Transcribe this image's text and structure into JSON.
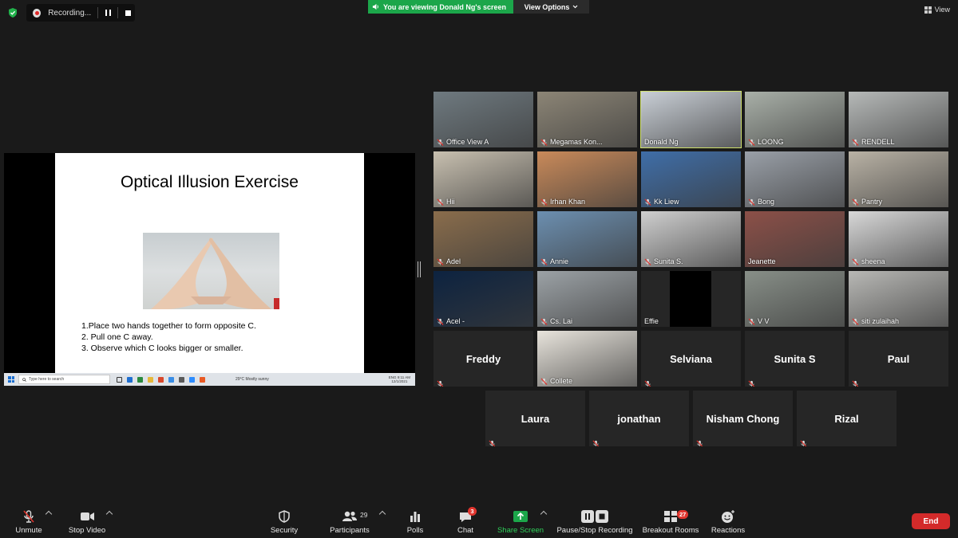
{
  "recording": {
    "label": "Recording..."
  },
  "banner": {
    "viewing_text": "You are viewing Donald Ng's screen",
    "view_options": "View Options"
  },
  "view": {
    "label": "View"
  },
  "slide": {
    "title": "Optical Illusion Exercise",
    "steps": [
      "1.Place two hands together to form opposite C.",
      "2. Pull one C away.",
      "3. Observe which C looks bigger or smaller."
    ]
  },
  "taskbar": {
    "search_placeholder": "Type here to search",
    "weather": "29°C  Mostly sunny",
    "lang": "ENG",
    "time": "9:11 AM",
    "date": "12/1/2021"
  },
  "participants_grid": [
    {
      "name": "Office View A",
      "muted": true,
      "video": true,
      "bg": "#6f7a80"
    },
    {
      "name": "Megamas Kon...",
      "muted": true,
      "video": true,
      "bg": "#8c8576"
    },
    {
      "name": "Donald Ng",
      "muted": false,
      "video": true,
      "active": true,
      "bg": "#c9cfd6"
    },
    {
      "name": "LOONG",
      "muted": true,
      "video": true,
      "bg": "#a9b0a8"
    },
    {
      "name": "RENDELL",
      "muted": true,
      "video": true,
      "bg": "#b6b9b8"
    },
    {
      "name": "Hii",
      "muted": true,
      "video": true,
      "bg": "#c8c0b0"
    },
    {
      "name": "Irhan Khan",
      "muted": true,
      "video": true,
      "bg": "#c98a5a"
    },
    {
      "name": "Kk Liew",
      "muted": true,
      "video": true,
      "bg": "#3f6ea8"
    },
    {
      "name": "Bong",
      "muted": true,
      "video": true,
      "bg": "#9aa0a8"
    },
    {
      "name": "Pantry",
      "muted": true,
      "video": true,
      "bg": "#b9b2a5"
    },
    {
      "name": "Adel",
      "muted": true,
      "video": true,
      "bg": "#8a6d4c"
    },
    {
      "name": "Annie",
      "muted": true,
      "video": true,
      "bg": "#6c8fb0"
    },
    {
      "name": "Sunita S.",
      "muted": true,
      "video": true,
      "bg": "#cfcfcf"
    },
    {
      "name": "Jeanette",
      "muted": false,
      "video": true,
      "bg": "#8c5048"
    },
    {
      "name": "sheena",
      "muted": true,
      "video": true,
      "bg": "#d8d8d8"
    },
    {
      "name": "Acel -",
      "muted": true,
      "video": true,
      "bg": "#0d2340"
    },
    {
      "name": "Cs. Lai",
      "muted": true,
      "video": true,
      "bg": "#9ca2a6"
    },
    {
      "name": "Effie",
      "muted": false,
      "video": true,
      "bg": "#262626"
    },
    {
      "name": "V V",
      "muted": true,
      "video": true,
      "bg": "#888f88"
    },
    {
      "name": "siti zulaihah",
      "muted": true,
      "video": true,
      "bg": "#b8b8b5"
    },
    {
      "name": "Freddy",
      "muted": true,
      "video": false
    },
    {
      "name": "Collete",
      "muted": true,
      "video": true,
      "bg": "#e8e4dc"
    },
    {
      "name": "Selviana",
      "muted": true,
      "video": false
    },
    {
      "name": "Sunita S",
      "muted": true,
      "video": false
    },
    {
      "name": "Paul",
      "muted": true,
      "video": false
    }
  ],
  "participants_row": [
    {
      "name": "Laura",
      "muted": true
    },
    {
      "name": "jonathan",
      "muted": true
    },
    {
      "name": "Nisham Chong",
      "muted": true
    },
    {
      "name": "Rizal",
      "muted": true
    }
  ],
  "toolbar": {
    "unmute": "Unmute",
    "stop_video": "Stop Video",
    "security": "Security",
    "participants": "Participants",
    "participants_count": "29",
    "polls": "Polls",
    "chat": "Chat",
    "chat_badge": "3",
    "share_screen": "Share Screen",
    "recording": "Pause/Stop Recording",
    "breakout": "Breakout Rooms",
    "breakout_badge": "27",
    "reactions": "Reactions",
    "end": "End"
  },
  "colors": {
    "share_green": "#1ca64a",
    "end_red": "#d32a2a",
    "badge_red": "#e0352e",
    "active_outline": "#cfe06b"
  }
}
